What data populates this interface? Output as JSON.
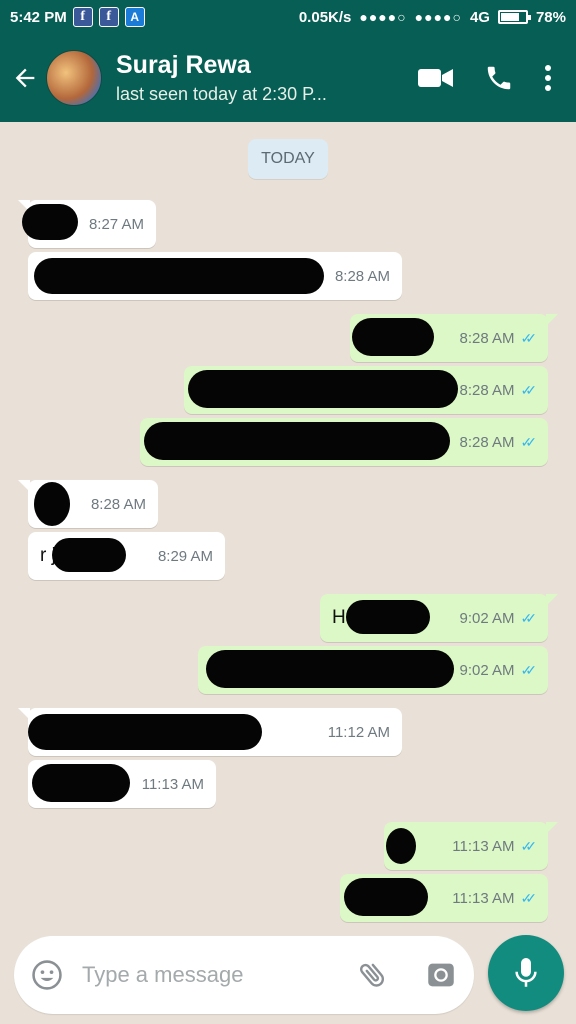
{
  "status": {
    "time": "5:42 PM",
    "speed": "0.05K/s",
    "network": "4G",
    "battery": "78%",
    "battery_level": 0.78,
    "notif_icons": [
      "facebook-icon",
      "facebook-icon",
      "app-store-icon"
    ]
  },
  "header": {
    "name": "Suraj Rewa",
    "last_seen": "last seen today at 2:30 P..."
  },
  "chat": {
    "date_chip": "TODAY",
    "messages": [
      {
        "dir": "in",
        "text": "",
        "time": "8:27 AM"
      },
      {
        "dir": "in",
        "text": "",
        "time": "8:28 AM"
      },
      {
        "dir": "out",
        "text": "",
        "time": "8:28 AM"
      },
      {
        "dir": "out",
        "text": "",
        "time": "8:28 AM"
      },
      {
        "dir": "out",
        "text": "",
        "time": "8:28 AM"
      },
      {
        "dir": "in",
        "text": "",
        "time": "8:28 AM"
      },
      {
        "dir": "in",
        "text": "r                  ji",
        "time": "8:29 AM"
      },
      {
        "dir": "out",
        "text": "H                  h",
        "time": "9:02 AM"
      },
      {
        "dir": "out",
        "text": "",
        "time": "9:02 AM"
      },
      {
        "dir": "in",
        "text": "                                                   ted",
        "time": "11:12 AM"
      },
      {
        "dir": "in",
        "text": "",
        "time": "11:13 AM"
      },
      {
        "dir": "out",
        "text": "",
        "time": "11:13 AM"
      },
      {
        "dir": "out",
        "text": "",
        "time": "11:13 AM"
      }
    ]
  },
  "composer": {
    "placeholder": "Type a message"
  },
  "colors": {
    "header": "#075e54",
    "outgoing": "#dcf8c6",
    "incoming": "#ffffff",
    "mic": "#128c7e",
    "read_tick": "#34b7f1"
  }
}
